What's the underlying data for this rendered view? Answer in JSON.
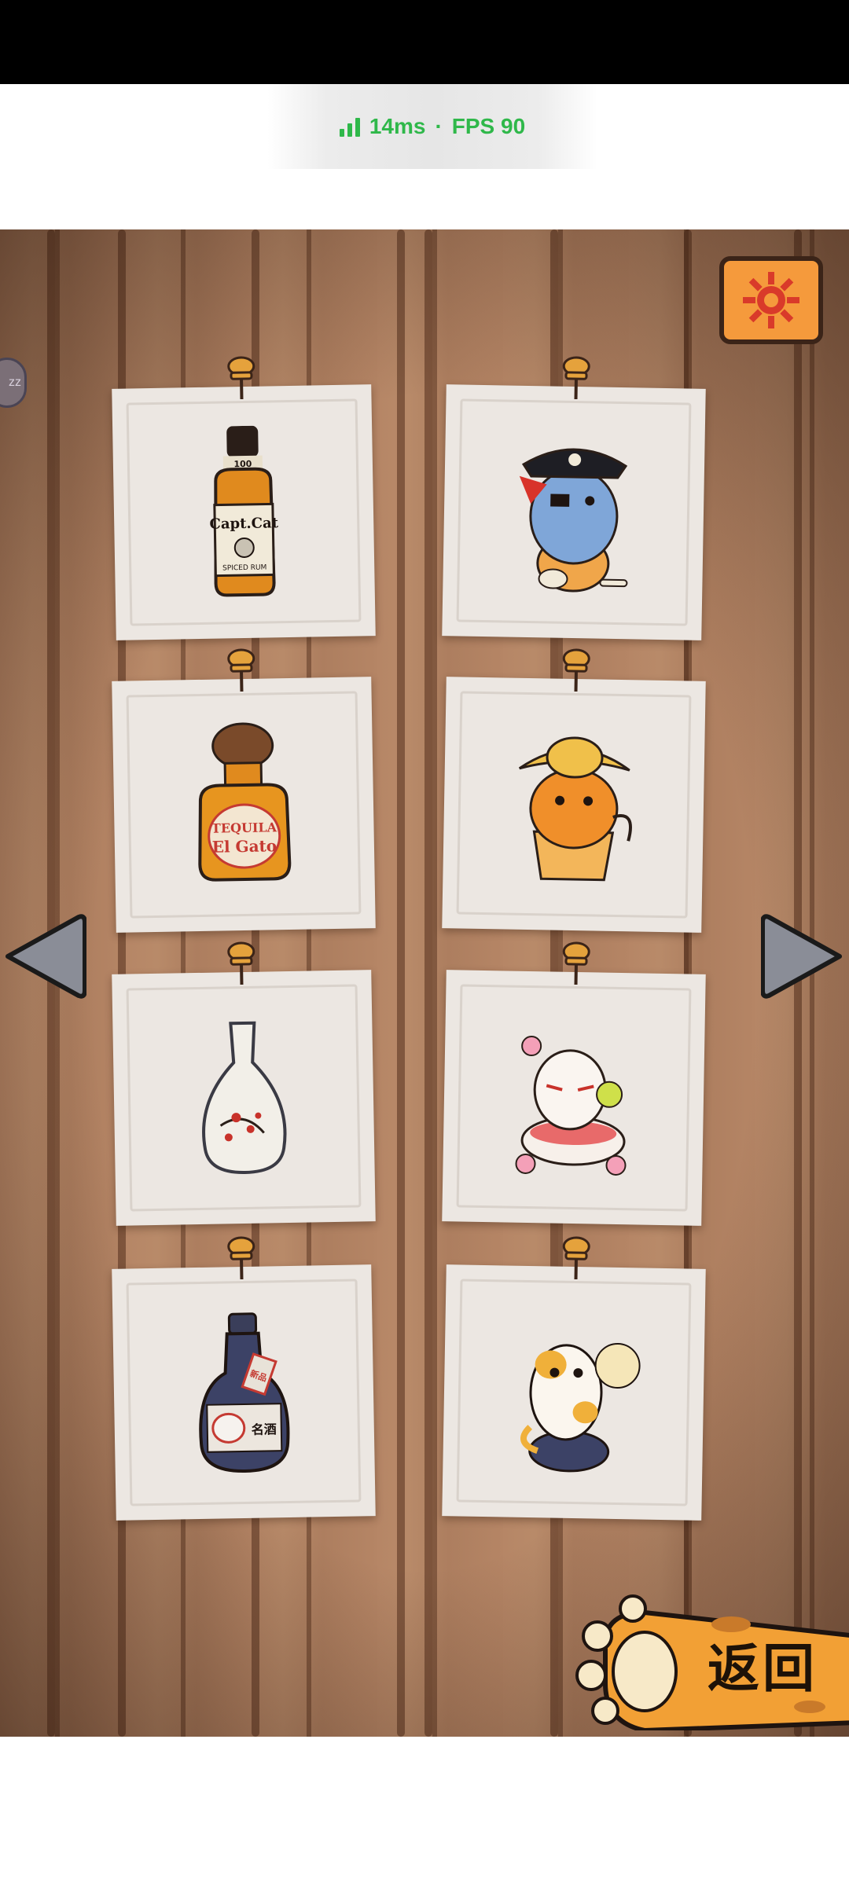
{
  "status": {
    "ping": "14ms",
    "separator": "·",
    "fps": "FPS 90",
    "color": "#2fb84a"
  },
  "side_icon": {
    "text": "zz"
  },
  "settings": {
    "icon": "gear-icon",
    "color": "#f59a3c"
  },
  "items": [
    {
      "name": "capt-cat-rum-bottle",
      "label": "Capt.Cat",
      "sub": "SPICED RUM",
      "top": "100"
    },
    {
      "name": "pirate-cat",
      "label": ""
    },
    {
      "name": "tequila-bottle",
      "label": "TEQUILA",
      "sub": "El Gato"
    },
    {
      "name": "sombrero-cat",
      "label": ""
    },
    {
      "name": "sake-vase",
      "label": ""
    },
    {
      "name": "sakura-cat",
      "label": ""
    },
    {
      "name": "mask-bottle",
      "label": "新品",
      "sub": "名酒"
    },
    {
      "name": "calico-cat",
      "label": ""
    }
  ],
  "nav": {
    "prev_icon": "triangle-left-icon",
    "next_icon": "triangle-right-icon"
  },
  "back_button": {
    "label": "返回",
    "icon": "paw-icon"
  }
}
